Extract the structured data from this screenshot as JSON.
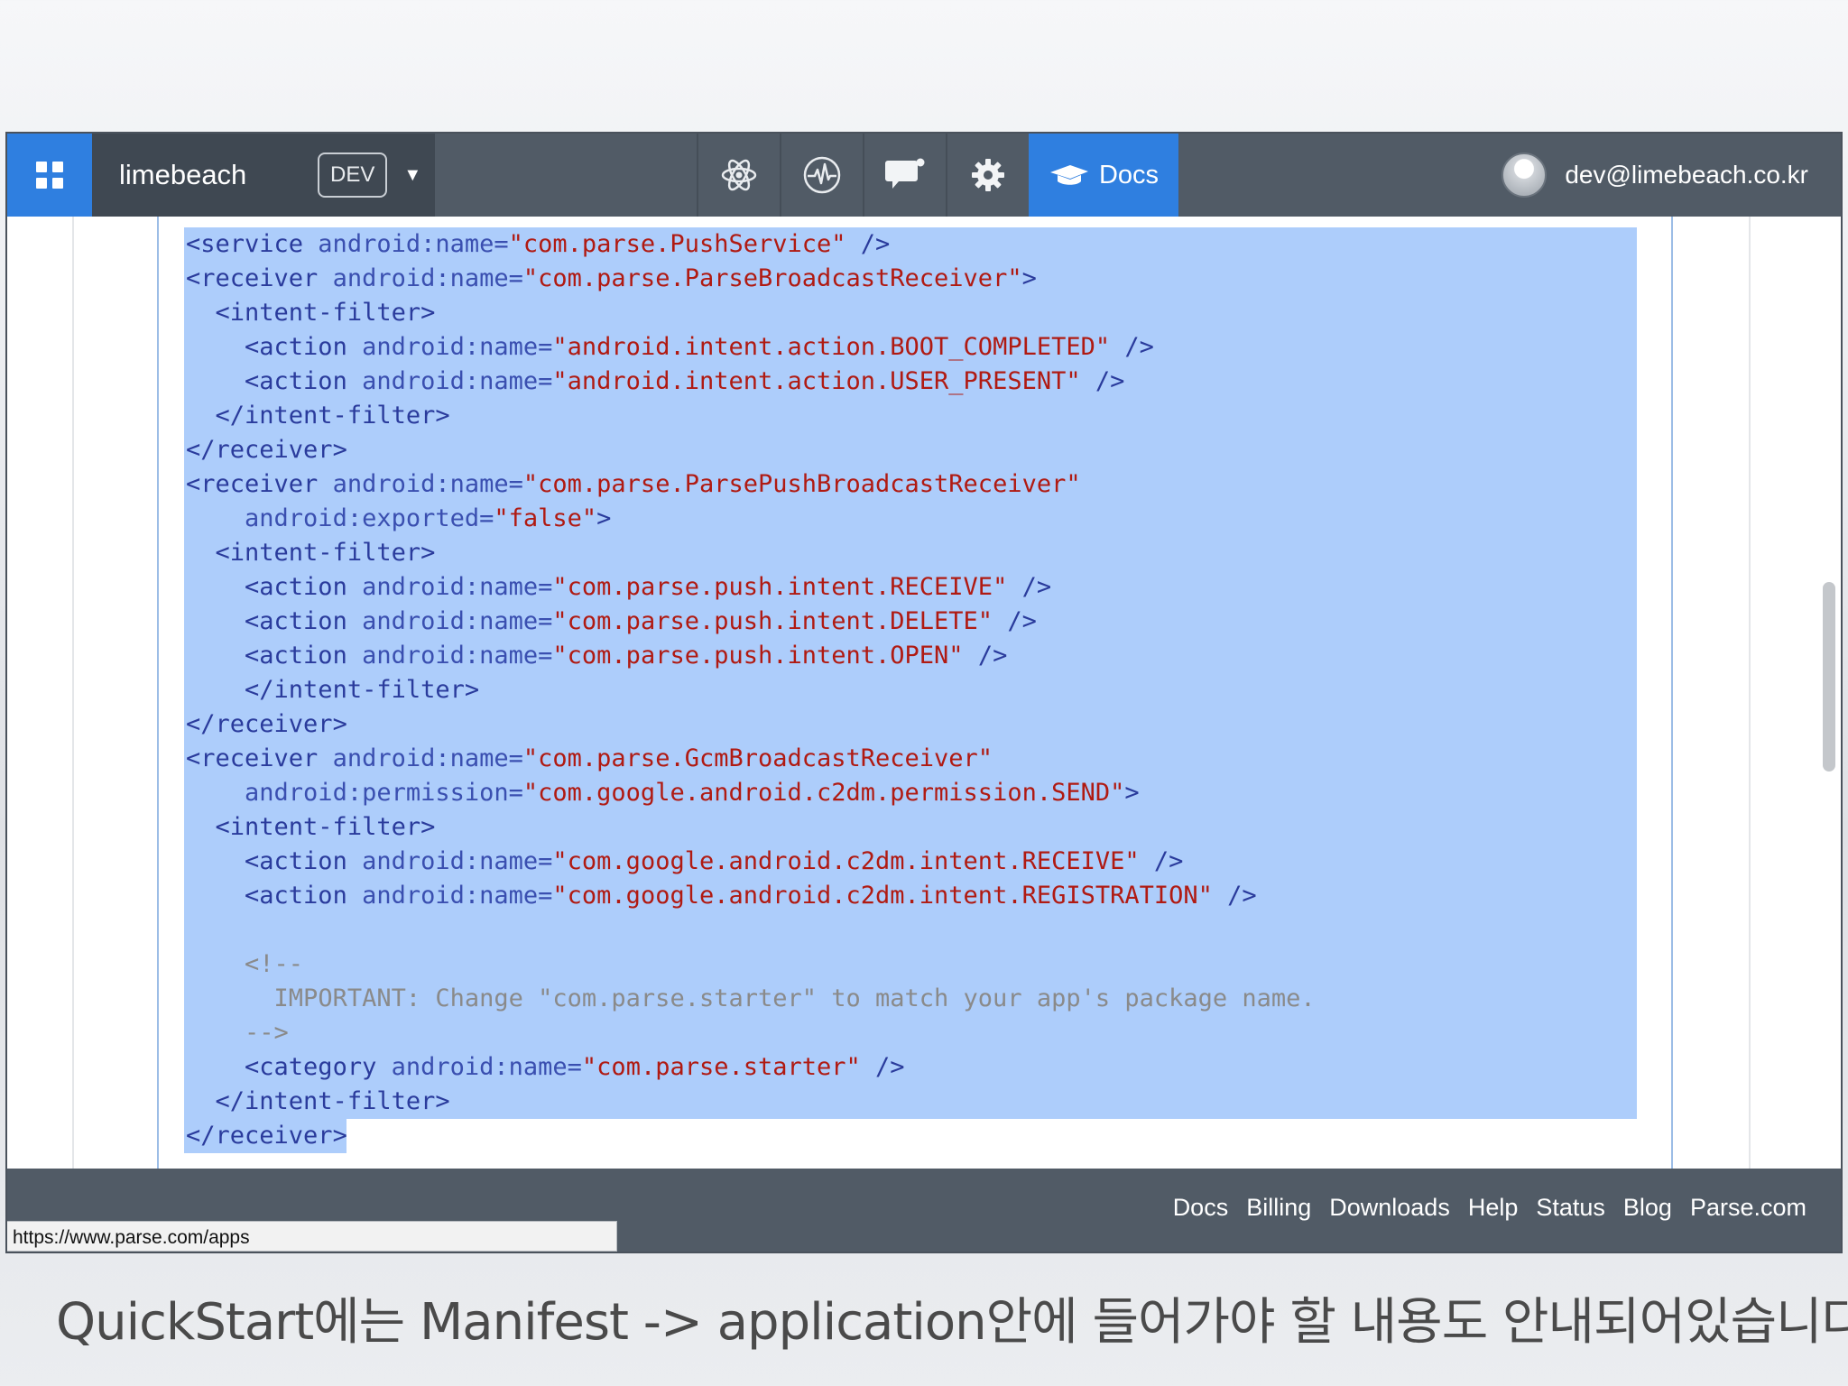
{
  "topbar": {
    "app_name": "limebeach",
    "env_badge": "DEV",
    "tools": [
      {
        "name": "core-atom-icon"
      },
      {
        "name": "analytics-pulse-icon"
      },
      {
        "name": "push-chat-icon"
      },
      {
        "name": "settings-gear-icon"
      }
    ],
    "docs_label": "Docs",
    "user_email": "dev@limebeach.co.kr"
  },
  "code_lines": [
    {
      "indent": "",
      "tag": "<service",
      "attr": " android:name=",
      "value": "\"com.parse.PushService\"",
      "end": " />"
    },
    {
      "indent": "",
      "tag": "<receiver",
      "attr": " android:name=",
      "value": "\"com.parse.ParseBroadcastReceiver\"",
      "end": ">"
    },
    {
      "indent": "  ",
      "tag": "<intent-filter",
      "attr": "",
      "value": "",
      "end": ">"
    },
    {
      "indent": "    ",
      "tag": "<action",
      "attr": " android:name=",
      "value": "\"android.intent.action.BOOT_COMPLETED\"",
      "end": " />"
    },
    {
      "indent": "    ",
      "tag": "<action",
      "attr": " android:name=",
      "value": "\"android.intent.action.USER_PRESENT\"",
      "end": " />"
    },
    {
      "indent": "  ",
      "tag": "</intent-filter",
      "attr": "",
      "value": "",
      "end": ">"
    },
    {
      "indent": "",
      "tag": "</receiver",
      "attr": "",
      "value": "",
      "end": ">"
    },
    {
      "indent": "",
      "tag": "<receiver",
      "attr": " android:name=",
      "value": "\"com.parse.ParsePushBroadcastReceiver\"",
      "end": ""
    },
    {
      "indent": "    ",
      "tag": "",
      "attr": "android:exported=",
      "value": "\"false\"",
      "end": ">"
    },
    {
      "indent": "  ",
      "tag": "<intent-filter",
      "attr": "",
      "value": "",
      "end": ">"
    },
    {
      "indent": "    ",
      "tag": "<action",
      "attr": " android:name=",
      "value": "\"com.parse.push.intent.RECEIVE\"",
      "end": " />"
    },
    {
      "indent": "    ",
      "tag": "<action",
      "attr": " android:name=",
      "value": "\"com.parse.push.intent.DELETE\"",
      "end": " />"
    },
    {
      "indent": "    ",
      "tag": "<action",
      "attr": " android:name=",
      "value": "\"com.parse.push.intent.OPEN\"",
      "end": " />"
    },
    {
      "indent": "    ",
      "tag": "</intent-filter",
      "attr": "",
      "value": "",
      "end": ">"
    },
    {
      "indent": "",
      "tag": "</receiver",
      "attr": "",
      "value": "",
      "end": ">"
    },
    {
      "indent": "",
      "tag": "<receiver",
      "attr": " android:name=",
      "value": "\"com.parse.GcmBroadcastReceiver\"",
      "end": ""
    },
    {
      "indent": "    ",
      "tag": "",
      "attr": "android:permission=",
      "value": "\"com.google.android.c2dm.permission.SEND\"",
      "end": ">"
    },
    {
      "indent": "  ",
      "tag": "<intent-filter",
      "attr": "",
      "value": "",
      "end": ">"
    },
    {
      "indent": "    ",
      "tag": "<action",
      "attr": " android:name=",
      "value": "\"com.google.android.c2dm.intent.RECEIVE\"",
      "end": " />"
    },
    {
      "indent": "    ",
      "tag": "<action",
      "attr": " android:name=",
      "value": "\"com.google.android.c2dm.intent.REGISTRATION\"",
      "end": " />"
    },
    {
      "indent": "",
      "tag": "",
      "attr": "",
      "value": "",
      "end": "",
      "comment": ""
    },
    {
      "indent": "    ",
      "tag": "",
      "attr": "",
      "value": "",
      "end": "",
      "comment": "<!--"
    },
    {
      "indent": "      ",
      "tag": "",
      "attr": "",
      "value": "",
      "end": "",
      "comment": "IMPORTANT: Change \"com.parse.starter\" to match your app's package name."
    },
    {
      "indent": "    ",
      "tag": "",
      "attr": "",
      "value": "",
      "end": "",
      "comment": "-->"
    },
    {
      "indent": "    ",
      "tag": "<category",
      "attr": " android:name=",
      "value": "\"com.parse.starter\"",
      "end": " />"
    },
    {
      "indent": "  ",
      "tag": "</intent-filter",
      "attr": "",
      "value": "",
      "end": ">"
    },
    {
      "indent": "",
      "tag": "</receiver",
      "attr": "",
      "value": "",
      "end": ">"
    }
  ],
  "footer": {
    "links": [
      "Docs",
      "Billing",
      "Downloads",
      "Help",
      "Status",
      "Blog",
      "Parse.com"
    ]
  },
  "status_url": "https://www.parse.com/apps",
  "caption": "QuickStart에는 Manifest -> application안에 들어가야 할 내용도 안내되어있습니다.",
  "colors": {
    "accent_blue": "#2f7fe0",
    "topbar": "#515b66",
    "selection": "#adcdfb",
    "code_tag": "#2a3b9c",
    "code_attr": "#3a4fb0",
    "code_value": "#b01a12",
    "code_comment": "#8a8a8a"
  }
}
